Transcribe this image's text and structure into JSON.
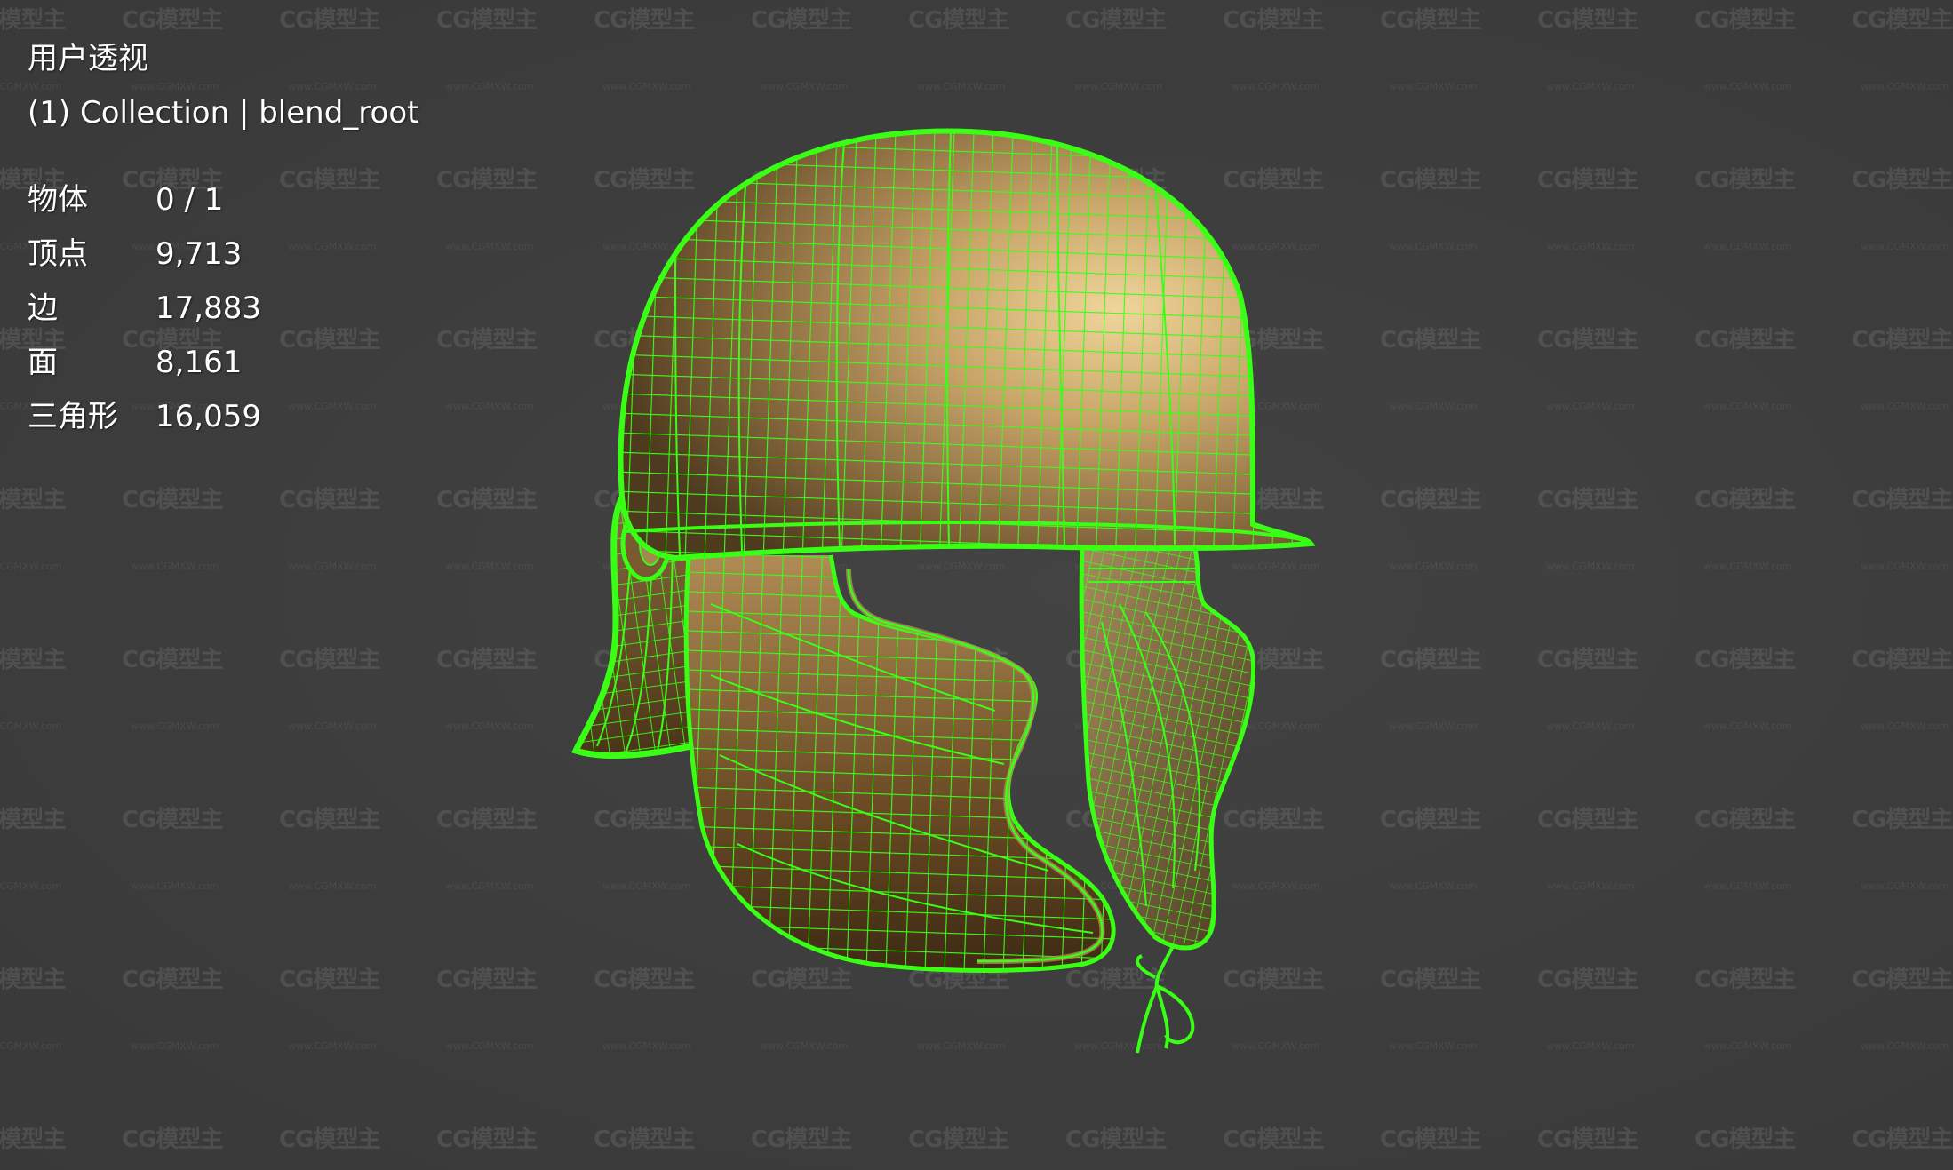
{
  "viewport": {
    "view_name": "用户透视",
    "collection_info": "(1) Collection | blend_root",
    "watermark_text": "CG模型主",
    "watermark_url": "www.CGMXW.com"
  },
  "stats": [
    {
      "label": "物体",
      "value": "0 / 1"
    },
    {
      "label": "顶点",
      "value": "9,713"
    },
    {
      "label": "边",
      "value": "17,883"
    },
    {
      "label": "面",
      "value": "8,161"
    },
    {
      "label": "三角形",
      "value": "16,059"
    }
  ],
  "colors": {
    "background": "#3d3d3d",
    "wireframe": "#39ff14",
    "metal_light": "#d8b77a",
    "metal_dark": "#4a3418"
  },
  "object": {
    "icon": "helmet-wireframe"
  }
}
